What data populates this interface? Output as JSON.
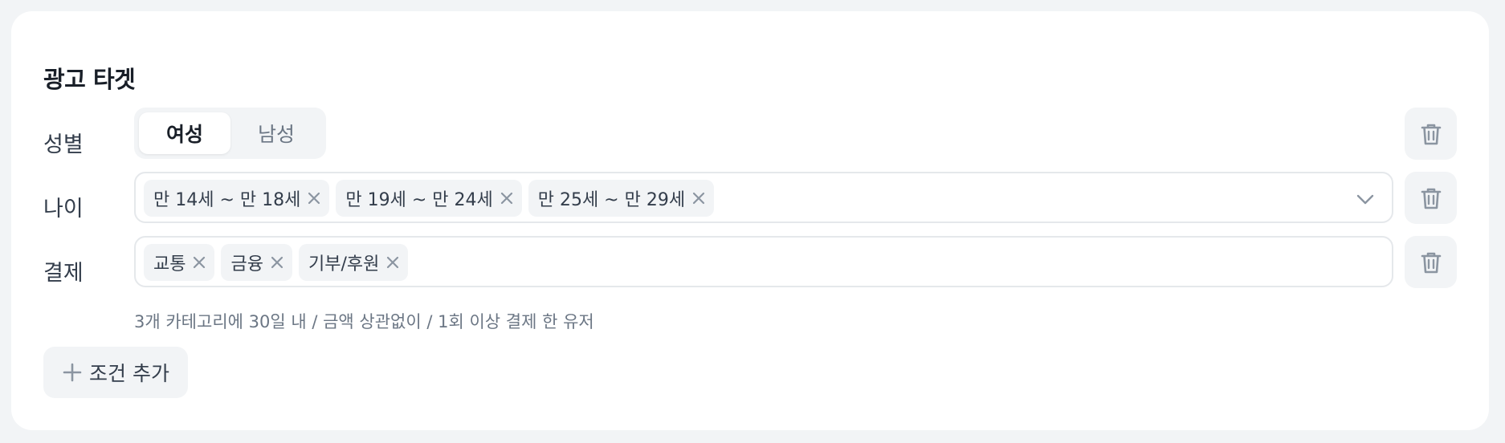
{
  "title": "광고 타겟",
  "gender": {
    "label": "성별",
    "options": [
      "여성",
      "남성"
    ],
    "selected": "여성"
  },
  "age": {
    "label": "나이",
    "chips": [
      "만 14세 ~ 만 18세",
      "만 19세 ~ 만 24세",
      "만 25세 ~ 만 29세"
    ]
  },
  "payment": {
    "label": "결제",
    "chips": [
      "교통",
      "금융",
      "기부/후원"
    ],
    "hint": "3개 카테고리에 30일 내 / 금액 상관없이 / 1회 이상 결제 한 유저"
  },
  "add_condition": "조건 추가",
  "colors": {
    "bg": "#f2f4f6",
    "card": "#ffffff",
    "text": "#333d4b",
    "muted": "#6b7684",
    "icon": "#8b95a1",
    "border": "#e5e8eb"
  }
}
